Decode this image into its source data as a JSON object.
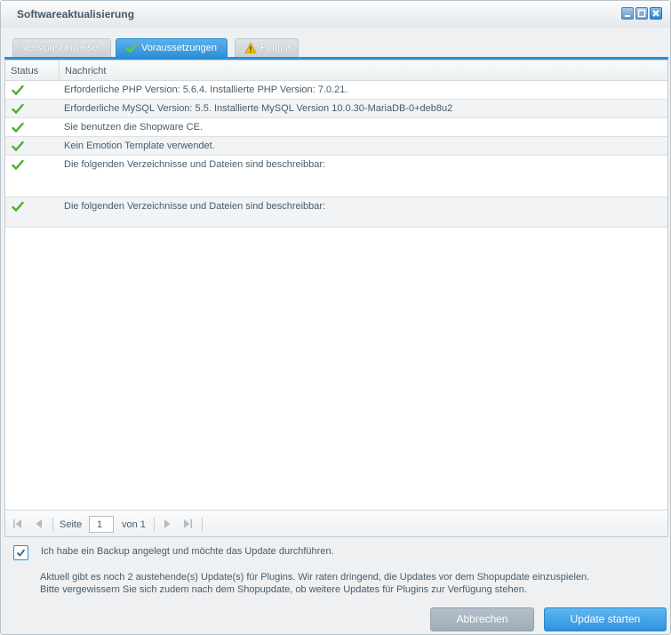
{
  "window": {
    "title": "Softwareaktualisierung",
    "controls": [
      "minimize-icon",
      "maximize-icon",
      "close-icon"
    ]
  },
  "tabs": [
    {
      "label": "Versionshinweise",
      "icon": null,
      "active": false
    },
    {
      "label": "Voraussetzungen",
      "icon": "check-icon",
      "active": true
    },
    {
      "label": "Plugins",
      "icon": "warning-icon",
      "active": false
    }
  ],
  "grid": {
    "columns": {
      "status": "Status",
      "message": "Nachricht"
    },
    "rows": [
      {
        "status": "ok",
        "message": "Erforderliche PHP Version: 5.6.4. Installierte PHP Version: 7.0.21."
      },
      {
        "status": "ok",
        "message": "Erforderliche MySQL Version: 5.5. Installierte MySQL Version 10.0.30-MariaDB-0+deb8u2"
      },
      {
        "status": "ok",
        "message": "Sie benutzen die Shopware CE."
      },
      {
        "status": "ok",
        "message": "Kein Emotion Template verwendet."
      },
      {
        "status": "ok",
        "message": "Die folgenden Verzeichnisse und Dateien sind beschreibbar:"
      },
      {
        "status": "ok",
        "message": "Die folgenden Verzeichnisse und Dateien sind beschreibbar:"
      }
    ]
  },
  "pager": {
    "page_label": "Seite",
    "page_value": "1",
    "of_label": "von 1"
  },
  "footer": {
    "backup_checked": true,
    "backup_label": "Ich habe ein Backup angelegt und möchte das Update durchführen.",
    "info_line1": "Aktuell gibt es noch 2 austehende(s) Update(s) für Plugins. Wir raten dringend, die Updates vor dem Shopupdate einzuspielen.",
    "info_line2": "Bitte vergewissern Sie sich zudem nach dem Shopupdate, ob weitere Updates für Plugins zur Verfügung stehen.",
    "cancel_label": "Abbrechen",
    "start_label": "Update starten"
  },
  "colors": {
    "accent": "#2a8fd8",
    "check": "#4caf2a",
    "warning": "#f2c200"
  }
}
